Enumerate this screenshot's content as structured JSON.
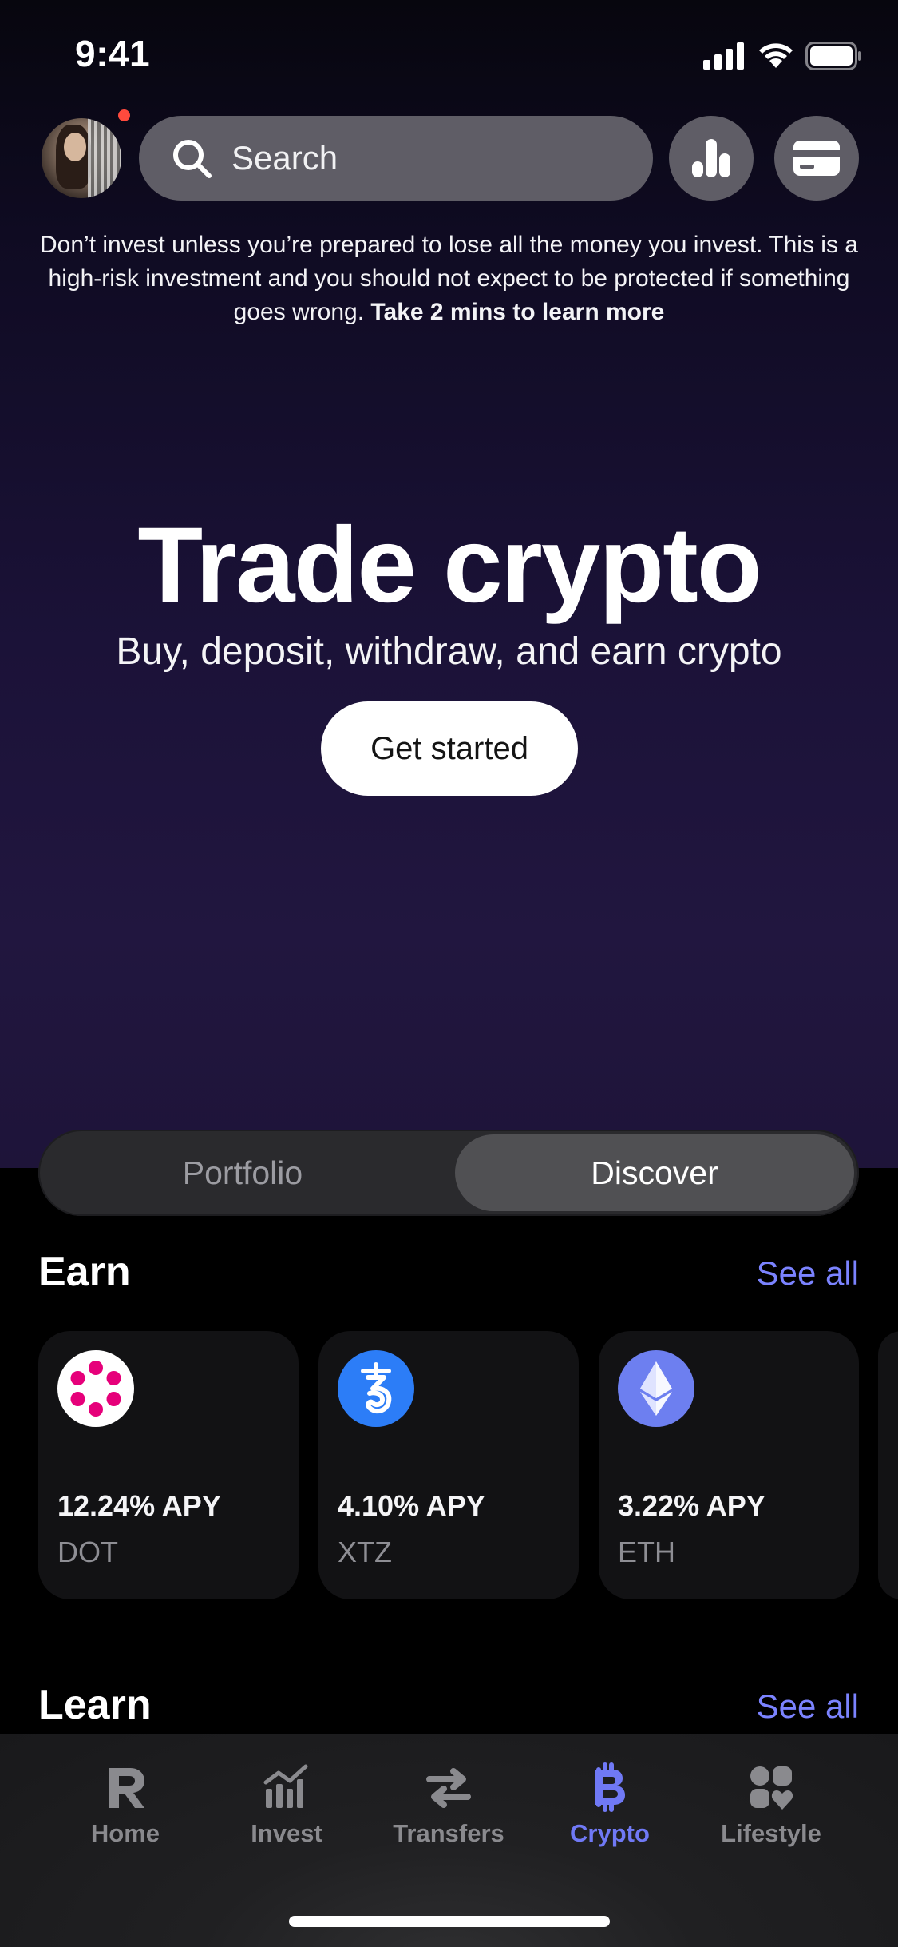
{
  "status_bar": {
    "time": "9:41"
  },
  "search": {
    "placeholder": "Search"
  },
  "disclaimer": {
    "text": "Don’t invest unless you’re prepared to lose all the money you invest. This is a high-risk investment and you should not expect to be protected if something goes wrong.",
    "link": "Take 2 mins to learn more"
  },
  "hero": {
    "title": "Trade crypto",
    "subtitle": "Buy, deposit, withdraw, and earn crypto",
    "cta": "Get started"
  },
  "segmented": {
    "options": [
      "Portfolio",
      "Discover"
    ],
    "selected": "Discover"
  },
  "earn": {
    "title": "Earn",
    "see_all": "See all",
    "cards": [
      {
        "apy": "12.24% APY",
        "ticker": "DOT",
        "icon": "polkadot-icon"
      },
      {
        "apy": "4.10% APY",
        "ticker": "XTZ",
        "icon": "tezos-icon"
      },
      {
        "apy": "3.22% APY",
        "ticker": "ETH",
        "icon": "ethereum-icon"
      }
    ]
  },
  "learn": {
    "title": "Learn",
    "see_all": "See all"
  },
  "bottom_nav": {
    "items": [
      {
        "label": "Home",
        "icon": "revolut-r-icon"
      },
      {
        "label": "Invest",
        "icon": "chart-bars-icon"
      },
      {
        "label": "Transfers",
        "icon": "transfer-arrows-icon"
      },
      {
        "label": "Crypto",
        "icon": "bitcoin-icon"
      },
      {
        "label": "Lifestyle",
        "icon": "lifestyle-icon"
      }
    ],
    "active": "Crypto"
  },
  "colors": {
    "accent": "#7b83ff",
    "nav_active": "#7079f5",
    "notification": "#ff4a3d",
    "polkadot": "#e6007a",
    "tezos": "#2c7df7",
    "ethereum": "#6d7ff0"
  }
}
